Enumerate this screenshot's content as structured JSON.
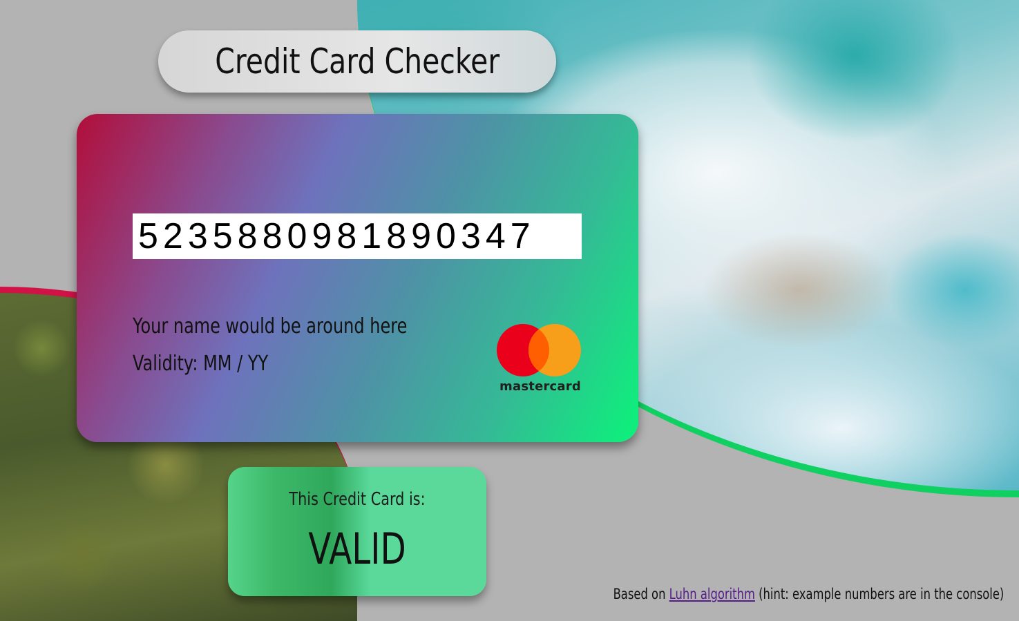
{
  "title": "Credit Card Checker",
  "card": {
    "number": "5235880981890347",
    "name": "Your name would be around here",
    "validity": "Validity: MM / YY",
    "brand": "mastercard",
    "brand_icon": "mastercard-logo"
  },
  "result": {
    "label": "This Credit Card is:",
    "status": "VALID"
  },
  "footer": {
    "prefix": "Based on",
    "link_text": "Luhn algorithm",
    "suffix": "(hint: example numbers are in the console)"
  },
  "colors": {
    "card_gradient_start": "#b20e3a",
    "card_gradient_mid": "#6e72bc",
    "card_gradient_end": "#0cf27a",
    "valid_green": "#5ad99b",
    "ocean_border": "#0fd060",
    "forest_border": "#d01246",
    "background": "#b3b3b3"
  }
}
